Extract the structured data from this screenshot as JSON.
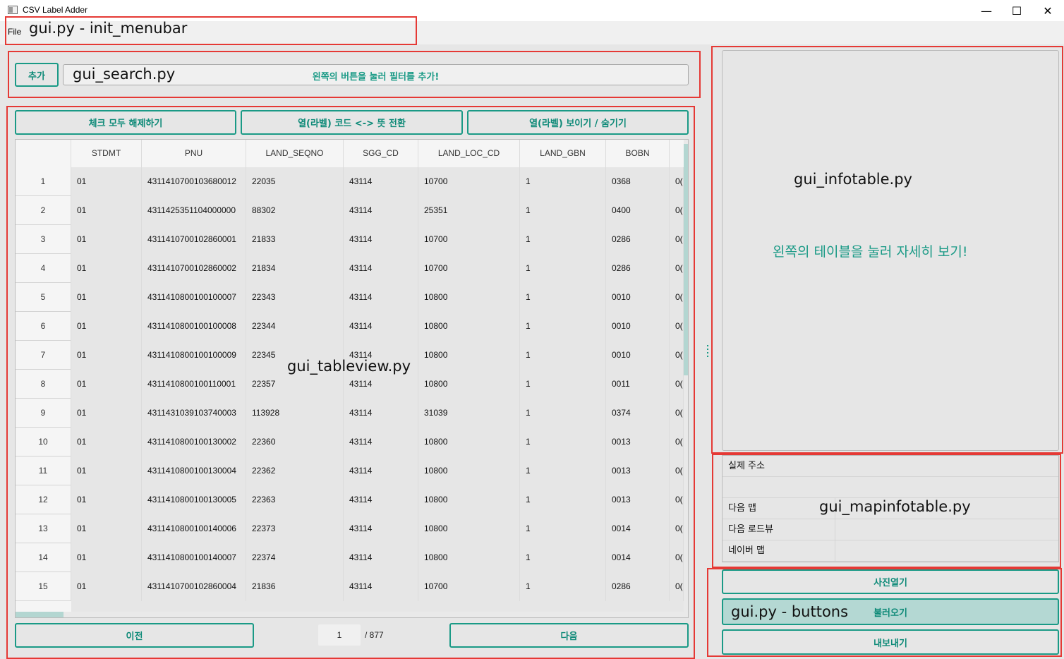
{
  "window": {
    "title": "CSV Label Adder",
    "min": "—",
    "max": "☐",
    "close": "✕"
  },
  "menubar": {
    "file": "File"
  },
  "annotations": {
    "menubar": "gui.py - init_menubar",
    "search": "gui_search.py",
    "tableview": "gui_tableview.py",
    "infotable": "gui_infotable.py",
    "mapinfotable": "gui_mapinfotable.py",
    "buttons": "gui.py - buttons"
  },
  "search": {
    "add_button": "추가",
    "hint": "왼쪽의 버튼을 눌러 필터를 추가!"
  },
  "toolbar": {
    "uncheck_all": "체크 모두 해제하기",
    "toggle_code": "열(라벨) 코드 <-> 뜻 전환",
    "toggle_visibility": "열(라벨) 보이기 / 숨기기"
  },
  "table": {
    "columns": [
      "STDMT",
      "PNU",
      "LAND_SEQNO",
      "SGG_CD",
      "LAND_LOC_CD",
      "LAND_GBN",
      "BOBN"
    ],
    "rows": [
      {
        "n": "1",
        "cells": [
          "01",
          "4311410700103680012",
          "22035",
          "43114",
          "10700",
          "1",
          "0368",
          "0("
        ]
      },
      {
        "n": "2",
        "cells": [
          "01",
          "4311425351104000000",
          "88302",
          "43114",
          "25351",
          "1",
          "0400",
          "0("
        ]
      },
      {
        "n": "3",
        "cells": [
          "01",
          "4311410700102860001",
          "21833",
          "43114",
          "10700",
          "1",
          "0286",
          "0("
        ]
      },
      {
        "n": "4",
        "cells": [
          "01",
          "4311410700102860002",
          "21834",
          "43114",
          "10700",
          "1",
          "0286",
          "0("
        ]
      },
      {
        "n": "5",
        "cells": [
          "01",
          "4311410800100100007",
          "22343",
          "43114",
          "10800",
          "1",
          "0010",
          "0("
        ]
      },
      {
        "n": "6",
        "cells": [
          "01",
          "4311410800100100008",
          "22344",
          "43114",
          "10800",
          "1",
          "0010",
          "0("
        ]
      },
      {
        "n": "7",
        "cells": [
          "01",
          "4311410800100100009",
          "22345",
          "43114",
          "10800",
          "1",
          "0010",
          "0("
        ]
      },
      {
        "n": "8",
        "cells": [
          "01",
          "4311410800100110001",
          "22357",
          "43114",
          "10800",
          "1",
          "0011",
          "0("
        ]
      },
      {
        "n": "9",
        "cells": [
          "01",
          "4311431039103740003",
          "113928",
          "43114",
          "31039",
          "1",
          "0374",
          "0("
        ]
      },
      {
        "n": "10",
        "cells": [
          "01",
          "4311410800100130002",
          "22360",
          "43114",
          "10800",
          "1",
          "0013",
          "0("
        ]
      },
      {
        "n": "11",
        "cells": [
          "01",
          "4311410800100130004",
          "22362",
          "43114",
          "10800",
          "1",
          "0013",
          "0("
        ]
      },
      {
        "n": "12",
        "cells": [
          "01",
          "4311410800100130005",
          "22363",
          "43114",
          "10800",
          "1",
          "0013",
          "0("
        ]
      },
      {
        "n": "13",
        "cells": [
          "01",
          "4311410800100140006",
          "22373",
          "43114",
          "10800",
          "1",
          "0014",
          "0("
        ]
      },
      {
        "n": "14",
        "cells": [
          "01",
          "4311410800100140007",
          "22374",
          "43114",
          "10800",
          "1",
          "0014",
          "0("
        ]
      },
      {
        "n": "15",
        "cells": [
          "01",
          "4311410700102860004",
          "21836",
          "43114",
          "10700",
          "1",
          "0286",
          "0("
        ]
      }
    ]
  },
  "pagination": {
    "prev": "이전",
    "page": "1",
    "total": "/ 877",
    "next": "다음"
  },
  "info": {
    "hint": "왼쪽의 테이블을 눌러 자세히 보기!"
  },
  "map_info": {
    "rows": [
      "실제 주소",
      "",
      "다음 맵",
      "다음 로드뷰",
      "네이버 맵"
    ]
  },
  "actions": {
    "open_photo": "사진열기",
    "load": "불러오기",
    "export": "내보내기"
  },
  "colors": {
    "accent": "#1a9a86",
    "annotation_box": "#e53935",
    "highlight_button": "#b4d8d3"
  }
}
